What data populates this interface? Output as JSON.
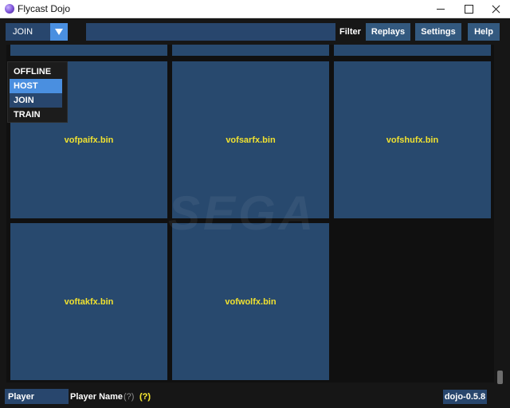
{
  "window": {
    "title": "Flycast Dojo"
  },
  "toolbar": {
    "mode_value": "JOIN",
    "filter_value": "",
    "filter_label": "Filter",
    "replays_label": "Replays",
    "settings_label": "Settings",
    "help_label": "Help"
  },
  "mode_menu": {
    "items": [
      {
        "label": "OFFLINE"
      },
      {
        "label": "HOST"
      },
      {
        "label": "JOIN"
      },
      {
        "label": "TRAIN"
      }
    ],
    "hovered": "HOST",
    "selected": "JOIN"
  },
  "games": [
    {
      "title": ""
    },
    {
      "title": ""
    },
    {
      "title": ""
    },
    {
      "title": "vofpaifx.bin"
    },
    {
      "title": "vofsarfx.bin"
    },
    {
      "title": "vofshufx.bin"
    },
    {
      "title": "voftakfx.bin"
    },
    {
      "title": "vofwolfx.bin"
    }
  ],
  "watermark": "SEGA",
  "status": {
    "player_value": "Player",
    "player_name_label": "Player Name",
    "help_marker": "(?)",
    "version": "dojo-0.5.8",
    "version_help": "(?)"
  },
  "colors": {
    "tile": "#28496e",
    "accent": "#4a8fe0",
    "input_bg": "#28466d",
    "title_text": "#f0e130"
  },
  "icons": {
    "app": "flycast-app-icon",
    "dropdown": "caret-down-icon",
    "minimize": "minimize-icon",
    "maximize": "maximize-icon",
    "close": "close-icon"
  }
}
